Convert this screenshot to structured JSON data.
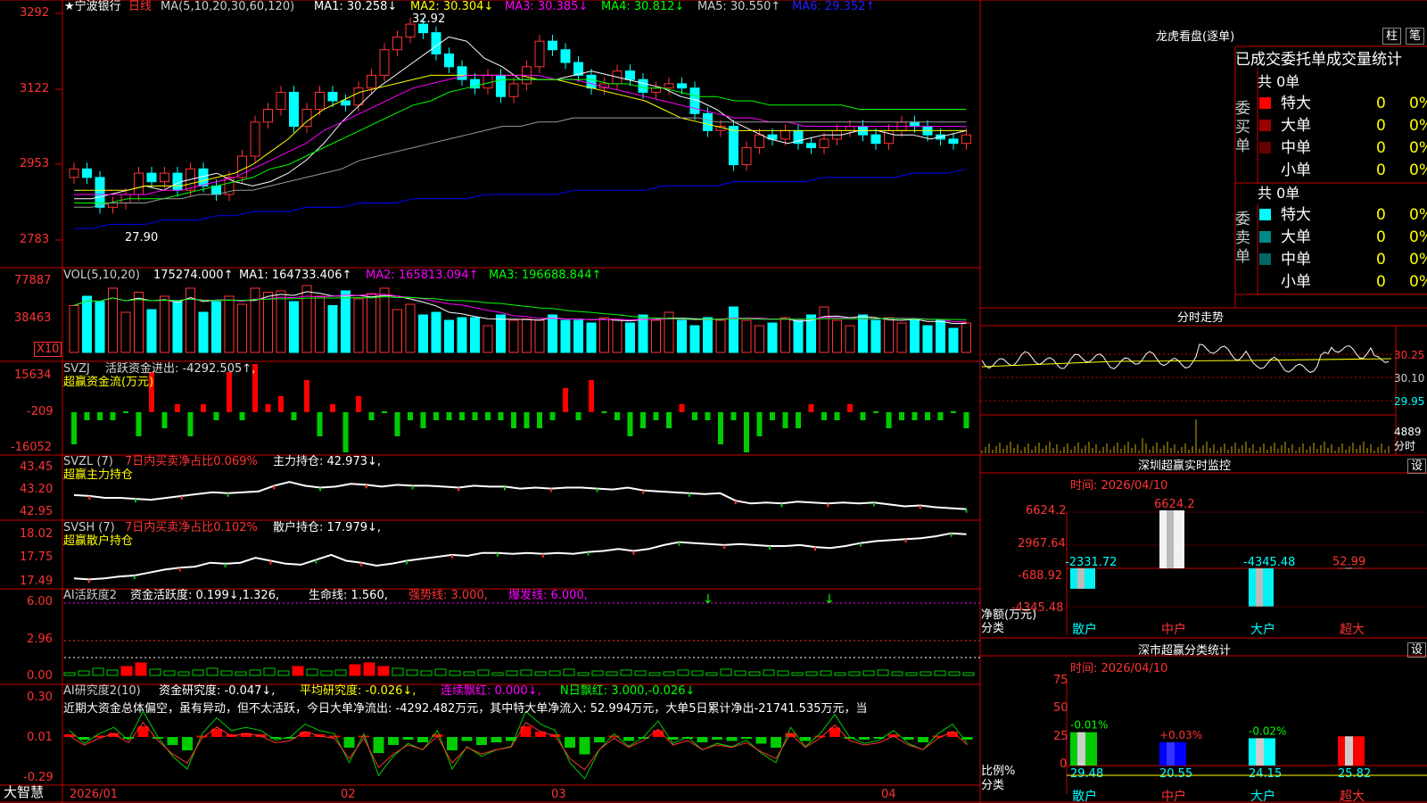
{
  "window": {
    "stock": "★宁波银行",
    "period": "日线",
    "brand": "大智慧"
  },
  "price": {
    "ma_label": "MA(5,10,20,30,60,120)",
    "ma": [
      {
        "text": "MA1: 30.258↓",
        "color": "#ffffff"
      },
      {
        "text": "MA2: 30.304↓",
        "color": "#ffff00"
      },
      {
        "text": "MA3: 30.385↓",
        "color": "#ff00ff"
      },
      {
        "text": "MA4: 30.812↓",
        "color": "#00ff00"
      },
      {
        "text": "MA5: 30.550↑",
        "color": "#cccccc"
      },
      {
        "text": "MA6: 29.352↑",
        "color": "#0000ff"
      }
    ],
    "yticks": [
      "3292",
      "3122",
      "2953",
      "2783"
    ],
    "high_label": "32.92",
    "low_label": "27.90",
    "ylim": [
      27.5,
      33.2
    ],
    "closes": [
      29.4,
      29.2,
      28.5,
      28.6,
      28.8,
      29.3,
      29.1,
      29.3,
      28.9,
      29.4,
      29.0,
      28.8,
      29.2,
      29.7,
      30.5,
      30.8,
      31.2,
      30.4,
      30.8,
      31.2,
      31.0,
      30.9,
      31.3,
      31.6,
      32.2,
      32.5,
      32.8,
      32.6,
      32.1,
      31.8,
      31.5,
      31.3,
      31.6,
      31.1,
      31.4,
      31.8,
      32.4,
      32.2,
      31.9,
      31.6,
      31.3,
      31.4,
      31.7,
      31.5,
      31.2,
      31.3,
      31.4,
      31.3,
      30.7,
      30.3,
      30.4,
      29.5,
      29.9,
      30.2,
      30.1,
      30.3,
      30.0,
      29.9,
      30.1,
      30.3,
      30.4,
      30.2,
      30.0,
      30.3,
      30.5,
      30.4,
      30.2,
      30.1,
      30.0,
      30.2
    ],
    "ma_series": [
      {
        "color": "#ffffff",
        "values": [
          28.7,
          28.7,
          28.8,
          28.9,
          29.0,
          28.9,
          29.1,
          29.2,
          29.3,
          29.1,
          29.0,
          29.1,
          29.3,
          29.6,
          30.0,
          30.5,
          30.9,
          31.3,
          31.6,
          31.9,
          32.2,
          32.5,
          32.4,
          32.0,
          31.8,
          31.5,
          31.5,
          31.5,
          31.6,
          31.7,
          31.6,
          31.5,
          31.4,
          31.3,
          31.1,
          31.0,
          30.8,
          30.5,
          30.3,
          30.1,
          30.0,
          30.1,
          30.2,
          30.2,
          30.3,
          30.3,
          30.2,
          30.2,
          30.1,
          30.2,
          30.3
        ]
      },
      {
        "color": "#ffff00",
        "values": [
          28.9,
          28.9,
          28.9,
          28.9,
          29.0,
          29.0,
          29.0,
          29.1,
          29.2,
          29.3,
          29.5,
          29.8,
          30.1,
          30.5,
          30.8,
          31.0,
          31.2,
          31.3,
          31.4,
          31.5,
          31.6,
          31.6,
          31.6,
          31.6,
          31.6,
          31.6,
          31.5,
          31.5,
          31.4,
          31.3,
          31.2,
          31.1,
          31.0,
          30.8,
          30.6,
          30.5,
          30.4,
          30.3,
          30.3,
          30.3,
          30.3,
          30.3,
          30.3,
          30.3,
          30.3,
          30.3,
          30.3,
          30.3,
          30.3,
          30.3,
          30.3
        ]
      },
      {
        "color": "#ff00ff",
        "values": [
          28.8,
          28.8,
          28.8,
          28.8,
          28.8,
          28.9,
          28.9,
          29.0,
          29.1,
          29.2,
          29.4,
          29.6,
          29.8,
          30.0,
          30.3,
          30.5,
          30.7,
          30.9,
          31.1,
          31.3,
          31.4,
          31.5,
          31.6,
          31.6,
          31.6,
          31.6,
          31.6,
          31.5,
          31.5,
          31.4,
          31.3,
          31.2,
          31.1,
          31.0,
          30.9,
          30.8,
          30.7,
          30.6,
          30.6,
          30.5,
          30.5,
          30.4,
          30.4,
          30.4,
          30.4,
          30.4,
          30.4,
          30.4,
          30.4,
          30.4,
          30.4
        ]
      },
      {
        "color": "#00ff00",
        "values": [
          28.6,
          28.6,
          28.6,
          28.7,
          28.7,
          28.7,
          28.8,
          28.9,
          29.0,
          29.1,
          29.2,
          29.4,
          29.5,
          29.7,
          29.9,
          30.1,
          30.3,
          30.5,
          30.7,
          30.9,
          31.0,
          31.2,
          31.3,
          31.4,
          31.5,
          31.5,
          31.5,
          31.5,
          31.5,
          31.5,
          31.4,
          31.4,
          31.3,
          31.3,
          31.2,
          31.1,
          31.1,
          31.0,
          31.0,
          30.9,
          30.9,
          30.9,
          30.9,
          30.9,
          30.8,
          30.8,
          30.8,
          30.8,
          30.8,
          30.8,
          30.8
        ]
      },
      {
        "color": "#999999",
        "values": [
          28.5,
          28.5,
          28.6,
          28.6,
          28.6,
          28.7,
          28.7,
          28.8,
          28.8,
          28.9,
          28.9,
          29.0,
          29.1,
          29.2,
          29.3,
          29.4,
          29.6,
          29.7,
          29.8,
          29.9,
          30.0,
          30.1,
          30.2,
          30.3,
          30.4,
          30.4,
          30.5,
          30.5,
          30.6,
          30.6,
          30.6,
          30.6,
          30.6,
          30.6,
          30.6,
          30.6,
          30.5,
          30.5,
          30.5,
          30.5,
          30.5,
          30.5,
          30.5,
          30.5,
          30.5,
          30.5,
          30.5,
          30.5,
          30.5,
          30.5,
          30.5
        ]
      },
      {
        "color": "#0000ff",
        "values": [
          28.0,
          28.0,
          28.1,
          28.1,
          28.1,
          28.2,
          28.2,
          28.2,
          28.3,
          28.3,
          28.4,
          28.4,
          28.4,
          28.5,
          28.5,
          28.5,
          28.6,
          28.6,
          28.6,
          28.7,
          28.7,
          28.7,
          28.7,
          28.8,
          28.8,
          28.8,
          28.8,
          28.8,
          28.9,
          28.9,
          28.9,
          28.9,
          28.9,
          29.0,
          29.0,
          29.0,
          29.0,
          29.1,
          29.1,
          29.1,
          29.1,
          29.1,
          29.2,
          29.2,
          29.2,
          29.2,
          29.2,
          29.3,
          29.3,
          29.3,
          29.4
        ]
      }
    ]
  },
  "volume": {
    "label": "VOL(5,10,20)",
    "value": "175274.000↑",
    "ma": [
      {
        "text": "MA1: 164733.406↑",
        "color": "#ffffff"
      },
      {
        "text": "MA2: 165813.094↑",
        "color": "#ff00ff"
      },
      {
        "text": "MA3: 196688.844↑",
        "color": "#00ff00"
      }
    ],
    "yticks": [
      "77887",
      "38463"
    ],
    "unit": "X10",
    "values": [
      35,
      42,
      38,
      48,
      30,
      45,
      32,
      42,
      38,
      48,
      30,
      38,
      42,
      36,
      48,
      45,
      46,
      38,
      50,
      42,
      35,
      46,
      40,
      44,
      48,
      32,
      36,
      28,
      30,
      24,
      26,
      26,
      20,
      28,
      24,
      25,
      24,
      28,
      24,
      24,
      22,
      26,
      24,
      22,
      28,
      24,
      30,
      24,
      20,
      26,
      24,
      34,
      24,
      20,
      22,
      26,
      24,
      28,
      34,
      24,
      20,
      28,
      24,
      26,
      22,
      24,
      20,
      24,
      18,
      22
    ]
  },
  "svzj": {
    "label": "SVZJ",
    "title": "活跃资金进出: -4292.505↑,",
    "subtitle": "超赢资金流(万元)",
    "yticks": [
      "15634",
      "-209",
      "-16052"
    ],
    "values": [
      -4,
      -1,
      -1,
      -1,
      0,
      -3,
      5,
      -2,
      1,
      -3,
      1,
      -1,
      5,
      -1,
      6,
      1,
      2,
      -1,
      4,
      -3,
      1,
      -5,
      2,
      -1,
      0,
      -3,
      -1,
      -2,
      -1,
      -1,
      -1,
      -1,
      -1,
      -1,
      -2,
      -2,
      -2,
      -1,
      3,
      -1,
      4,
      0,
      -1,
      -3,
      -2,
      -1,
      -2,
      1,
      -1,
      -1,
      -4,
      -1,
      -5,
      -3,
      -1,
      -2,
      -2,
      1,
      -1,
      -1,
      1,
      -1,
      0,
      -2,
      -1,
      -1,
      -1,
      -1,
      0,
      -2
    ]
  },
  "svzl": {
    "label": "SVZL (7)",
    "title": "7日内买卖净占比0.069%",
    "extra": "主力持仓: 42.973↓,",
    "subtitle": "超赢主力持仓",
    "yticks": [
      "43.45",
      "43.20",
      "42.95"
    ],
    "ylim": [
      42.9,
      43.5
    ],
    "values": [
      43.12,
      43.11,
      43.09,
      43.09,
      43.08,
      43.07,
      43.09,
      43.11,
      43.13,
      43.15,
      43.14,
      43.15,
      43.16,
      43.22,
      43.26,
      43.22,
      43.2,
      43.21,
      43.24,
      43.23,
      43.21,
      43.23,
      43.22,
      43.22,
      43.21,
      43.2,
      43.22,
      43.21,
      43.21,
      43.19,
      43.2,
      43.19,
      43.2,
      43.2,
      43.19,
      43.18,
      43.2,
      43.17,
      43.16,
      43.15,
      43.14,
      43.13,
      43.14,
      43.06,
      43.03,
      43.04,
      43.03,
      43.05,
      43.04,
      43.03,
      43.04,
      43.03,
      43.04,
      43.02,
      43.0,
      43.01,
      42.99,
      42.98,
      42.97
    ]
  },
  "svsh": {
    "label": "SVSH (7)",
    "title": "7日内买卖净占比0.102%",
    "extra": "散户持仓: 17.979↓,",
    "subtitle": "超赢散户持仓",
    "yticks": [
      "18.02",
      "17.75",
      "17.49"
    ],
    "ylim": [
      17.45,
      18.05
    ],
    "values": [
      17.52,
      17.51,
      17.52,
      17.54,
      17.55,
      17.58,
      17.61,
      17.63,
      17.64,
      17.68,
      17.67,
      17.68,
      17.73,
      17.7,
      17.67,
      17.66,
      17.71,
      17.76,
      17.7,
      17.68,
      17.65,
      17.67,
      17.7,
      17.72,
      17.74,
      17.76,
      17.75,
      17.78,
      17.78,
      17.77,
      17.78,
      17.77,
      17.78,
      17.77,
      17.79,
      17.8,
      17.82,
      17.8,
      17.82,
      17.86,
      17.89,
      17.88,
      17.87,
      17.86,
      17.87,
      17.86,
      17.85,
      17.85,
      17.86,
      17.84,
      17.83,
      17.85,
      17.88,
      17.9,
      17.91,
      17.92,
      17.93,
      17.95,
      17.98,
      17.97
    ]
  },
  "ai_active": {
    "label": "AI活跃度2",
    "title": "资金活跃度: 0.199↓,1.326,",
    "life": "生命线: 1.560,",
    "strong": "强势线: 3.000,",
    "burst": "爆发线: 6.000,",
    "yticks": [
      "6.00",
      "2.96",
      "0.00"
    ],
    "values": [
      0.3,
      0.5,
      0.8,
      0.6,
      1.0,
      1.4,
      0.7,
      0.5,
      0.4,
      0.6,
      0.8,
      0.5,
      0.4,
      0.6,
      0.8,
      0.5,
      1.0,
      0.7,
      0.5,
      0.6,
      1.2,
      1.4,
      1.0,
      0.8,
      0.6,
      0.5,
      0.7,
      0.5,
      0.4,
      0.6,
      0.3,
      0.5,
      0.6,
      0.4,
      0.5,
      0.7,
      0.3,
      0.5,
      0.4,
      0.6,
      0.5,
      0.3,
      0.4,
      0.6,
      0.5,
      0.3,
      0.7,
      0.5,
      0.4,
      0.6,
      0.5,
      0.3,
      0.4,
      0.5,
      0.3,
      0.4,
      0.5,
      0.6,
      0.4,
      0.3,
      0.4,
      0.5,
      0.4,
      0.3
    ]
  },
  "ai_research": {
    "label": "AI研究度2(10)",
    "title": "资金研究度: -0.047↓,",
    "avg": "平均研究度: -0.026↓,",
    "streak": "连续飘红: 0.000↓,",
    "nred": "N日飘红: 3.000,-0.026↓",
    "yticks": [
      "0.30",
      "0.01",
      "-0.29"
    ],
    "text": "近期大资金总体偏空，虽有异动，但不太活跃，今日大单净流出: -4292.482万元，其中特大单净流入: 52.994万元，大单5日累计净出-21741.535万元，当",
    "values": [
      0.02,
      -0.02,
      0.01,
      0.03,
      -0.01,
      0.08,
      0.0,
      -0.06,
      -0.1,
      0.01,
      0.06,
      0.02,
      0.03,
      0.02,
      -0.01,
      0.0,
      0.04,
      0.02,
      0.01,
      -0.08,
      0.01,
      -0.12,
      -0.06,
      -0.02,
      -0.04,
      0.02,
      -0.1,
      -0.03,
      -0.06,
      -0.04,
      -0.03,
      0.08,
      0.04,
      0.02,
      -0.08,
      -0.13,
      -0.04,
      0.01,
      -0.03,
      0.0,
      0.05,
      -0.02,
      0.0,
      -0.04,
      -0.02,
      -0.03,
      -0.01,
      -0.05,
      -0.08,
      0.03,
      -0.03,
      0.01,
      0.07,
      0.0,
      -0.02,
      -0.01,
      0.02,
      -0.02,
      -0.04,
      0.01,
      0.04,
      -0.02
    ]
  },
  "xaxis": {
    "labels": [
      "2026/01",
      "02",
      "03",
      "04"
    ]
  },
  "right": {
    "lhb": {
      "title": "龙虎看盘(逐单)",
      "btn_bar": "柱",
      "btn_detail": "笔",
      "header": "已成交委托单成交量统计",
      "buy_label": "委买单",
      "sell_label": "委卖单",
      "buy_total": "共 0单",
      "sell_total": "共 0单",
      "buy_rows": [
        {
          "name": "特大",
          "v": "0",
          "p": "0%",
          "c": "#ff0000"
        },
        {
          "name": "大单",
          "v": "0",
          "p": "0%",
          "c": "#990000"
        },
        {
          "name": "中单",
          "v": "0",
          "p": "0%",
          "c": "#660000"
        },
        {
          "name": "小单",
          "v": "0",
          "p": "0%",
          "c": "#000000"
        }
      ],
      "sell_rows": [
        {
          "name": "特大",
          "v": "0",
          "p": "0%",
          "c": "#00ffff"
        },
        {
          "name": "大单",
          "v": "0",
          "p": "0%",
          "c": "#008888"
        },
        {
          "name": "中单",
          "v": "0",
          "p": "0%",
          "c": "#006666"
        },
        {
          "name": "小单",
          "v": "0",
          "p": "0%",
          "c": "#000000"
        }
      ]
    },
    "intraday": {
      "title": "分时走势",
      "yticks": [
        "30.25",
        "30.10",
        "29.95"
      ],
      "vol_label": "4889",
      "vol_unit": "分时"
    },
    "monitor": {
      "title": "深圳超赢实时监控",
      "btn": "设",
      "time": "时间: 2026/04/10",
      "yticks": [
        "6624.2",
        "2967.64",
        "-688.92",
        "-4345.48"
      ],
      "ylabel": "净额(万元)",
      "xlabel": "分类",
      "categories": [
        "散户",
        "中户",
        "大户",
        "超大"
      ],
      "values": [
        -2331.72,
        6624.2,
        -4345.48,
        52.99
      ],
      "labels": [
        "-2331.72",
        "6624.2",
        "-4345.48",
        "52.99"
      ]
    },
    "classify": {
      "title": "深市超赢分类统计",
      "btn": "设",
      "time": "时间: 2026/04/10",
      "yticks": [
        "75",
        "50",
        "25",
        "0"
      ],
      "ylabel": "比例%",
      "xlabel": "分类",
      "categories": [
        "散户",
        "中户",
        "大户",
        "超大"
      ],
      "values": [
        29.48,
        20.55,
        24.15,
        25.82
      ],
      "changes": [
        "-0.01%",
        "+0.03%",
        "-0.02%",
        ""
      ],
      "colors": [
        "#00cc00",
        "#0000ff",
        "#00ffff",
        "#ff0000"
      ]
    }
  }
}
